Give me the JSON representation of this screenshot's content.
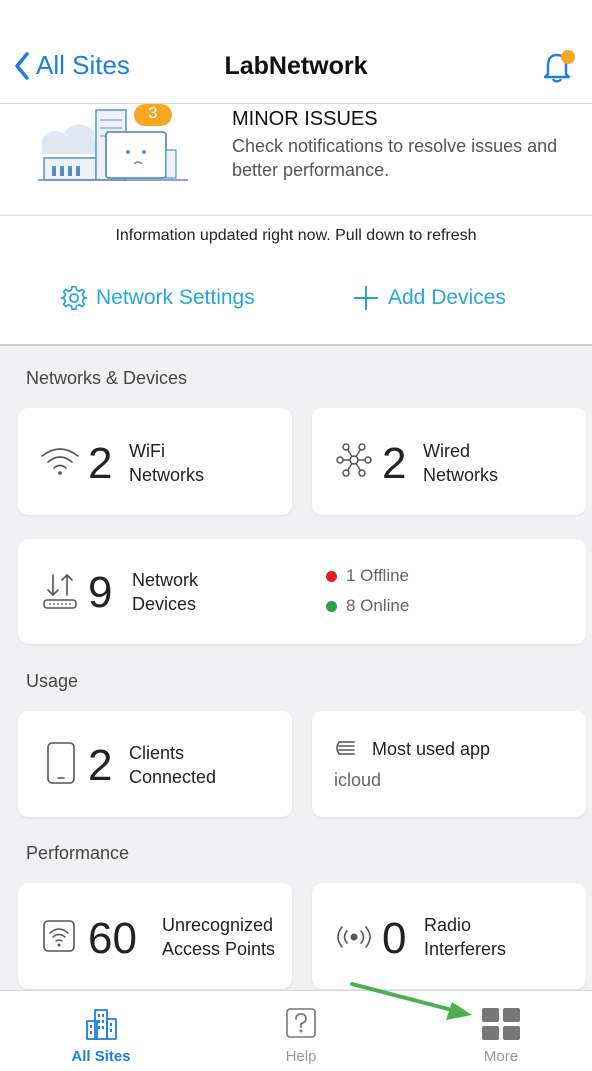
{
  "nav": {
    "back_label": "All Sites",
    "title": "LabNetwork"
  },
  "hero": {
    "badge_count": "3",
    "issue_title": "MINOR ISSUES",
    "issue_desc": "Check notifications to resolve issues and better performance."
  },
  "info_text": "Information updated right now. Pull down to refresh",
  "actions": {
    "settings_label": "Network Settings",
    "add_label": "Add Devices"
  },
  "sections": {
    "networks": "Networks & Devices",
    "usage": "Usage",
    "performance": "Performance"
  },
  "cards": {
    "wifi": {
      "count": "2",
      "line1": "WiFi",
      "line2": "Networks"
    },
    "wired": {
      "count": "2",
      "line1": "Wired",
      "line2": "Networks"
    },
    "devices": {
      "count": "9",
      "line1": "Network",
      "line2": "Devices",
      "offline": "1 Offline",
      "online": "8 Online"
    },
    "clients": {
      "count": "2",
      "line1": "Clients",
      "line2": "Connected"
    },
    "app": {
      "title": "Most used app",
      "value": "icloud"
    },
    "access_points": {
      "count": "60",
      "line1": "Unrecognized",
      "line2": "Access Points"
    },
    "radio": {
      "count": "0",
      "line1": "Radio",
      "line2": "Interferers"
    }
  },
  "tabs": {
    "all_sites": "All Sites",
    "help": "Help",
    "more": "More"
  },
  "colors": {
    "accent_blue": "#1b7fe0",
    "action_teal": "#26a6d9",
    "badge_orange": "#f5a623",
    "offline_red": "#e02020",
    "online_green": "#2ea043",
    "arrow_green": "#4caf50"
  }
}
